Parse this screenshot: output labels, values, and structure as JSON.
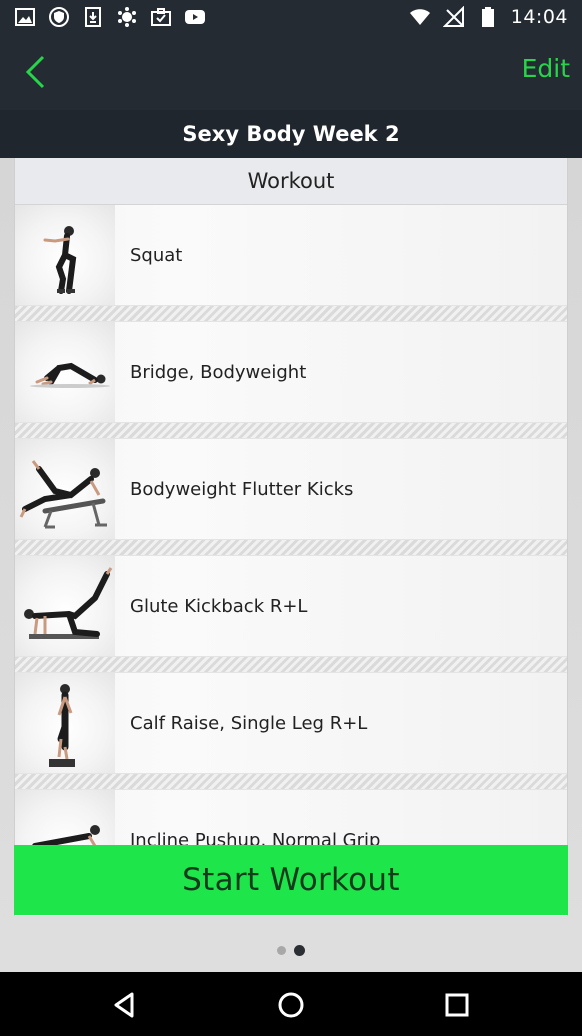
{
  "status_bar": {
    "left_icons": [
      "image-icon",
      "shield-icon",
      "download-icon",
      "android-icon",
      "briefcase-icon",
      "youtube-icon"
    ],
    "right_icons": [
      "wifi-icon",
      "no-signal-icon",
      "battery-icon"
    ],
    "time": "14:04"
  },
  "app_bar": {
    "back_icon": "chevron-left-icon",
    "edit_label": "Edit",
    "accent_color": "#27d54a"
  },
  "title": "Sexy Body Week 2",
  "section_header": "Workout",
  "exercises": [
    {
      "name": "Squat",
      "icon": "squat-figure"
    },
    {
      "name": "Bridge, Bodyweight",
      "icon": "bridge-figure"
    },
    {
      "name": "Bodyweight Flutter Kicks",
      "icon": "flutter-kicks-figure"
    },
    {
      "name": "Glute Kickback R+L",
      "icon": "glute-kickback-figure"
    },
    {
      "name": "Calf Raise, Single Leg R+L",
      "icon": "calf-raise-figure"
    },
    {
      "name": "Incline Pushup, Normal Grip",
      "icon": "incline-pushup-figure"
    }
  ],
  "start_button": {
    "label": "Start Workout",
    "color": "#1ee64a"
  },
  "pager": {
    "count": 2,
    "active_index": 1
  },
  "nav_bar": {
    "icons": [
      "back-triangle-icon",
      "home-circle-icon",
      "recents-square-icon"
    ]
  }
}
